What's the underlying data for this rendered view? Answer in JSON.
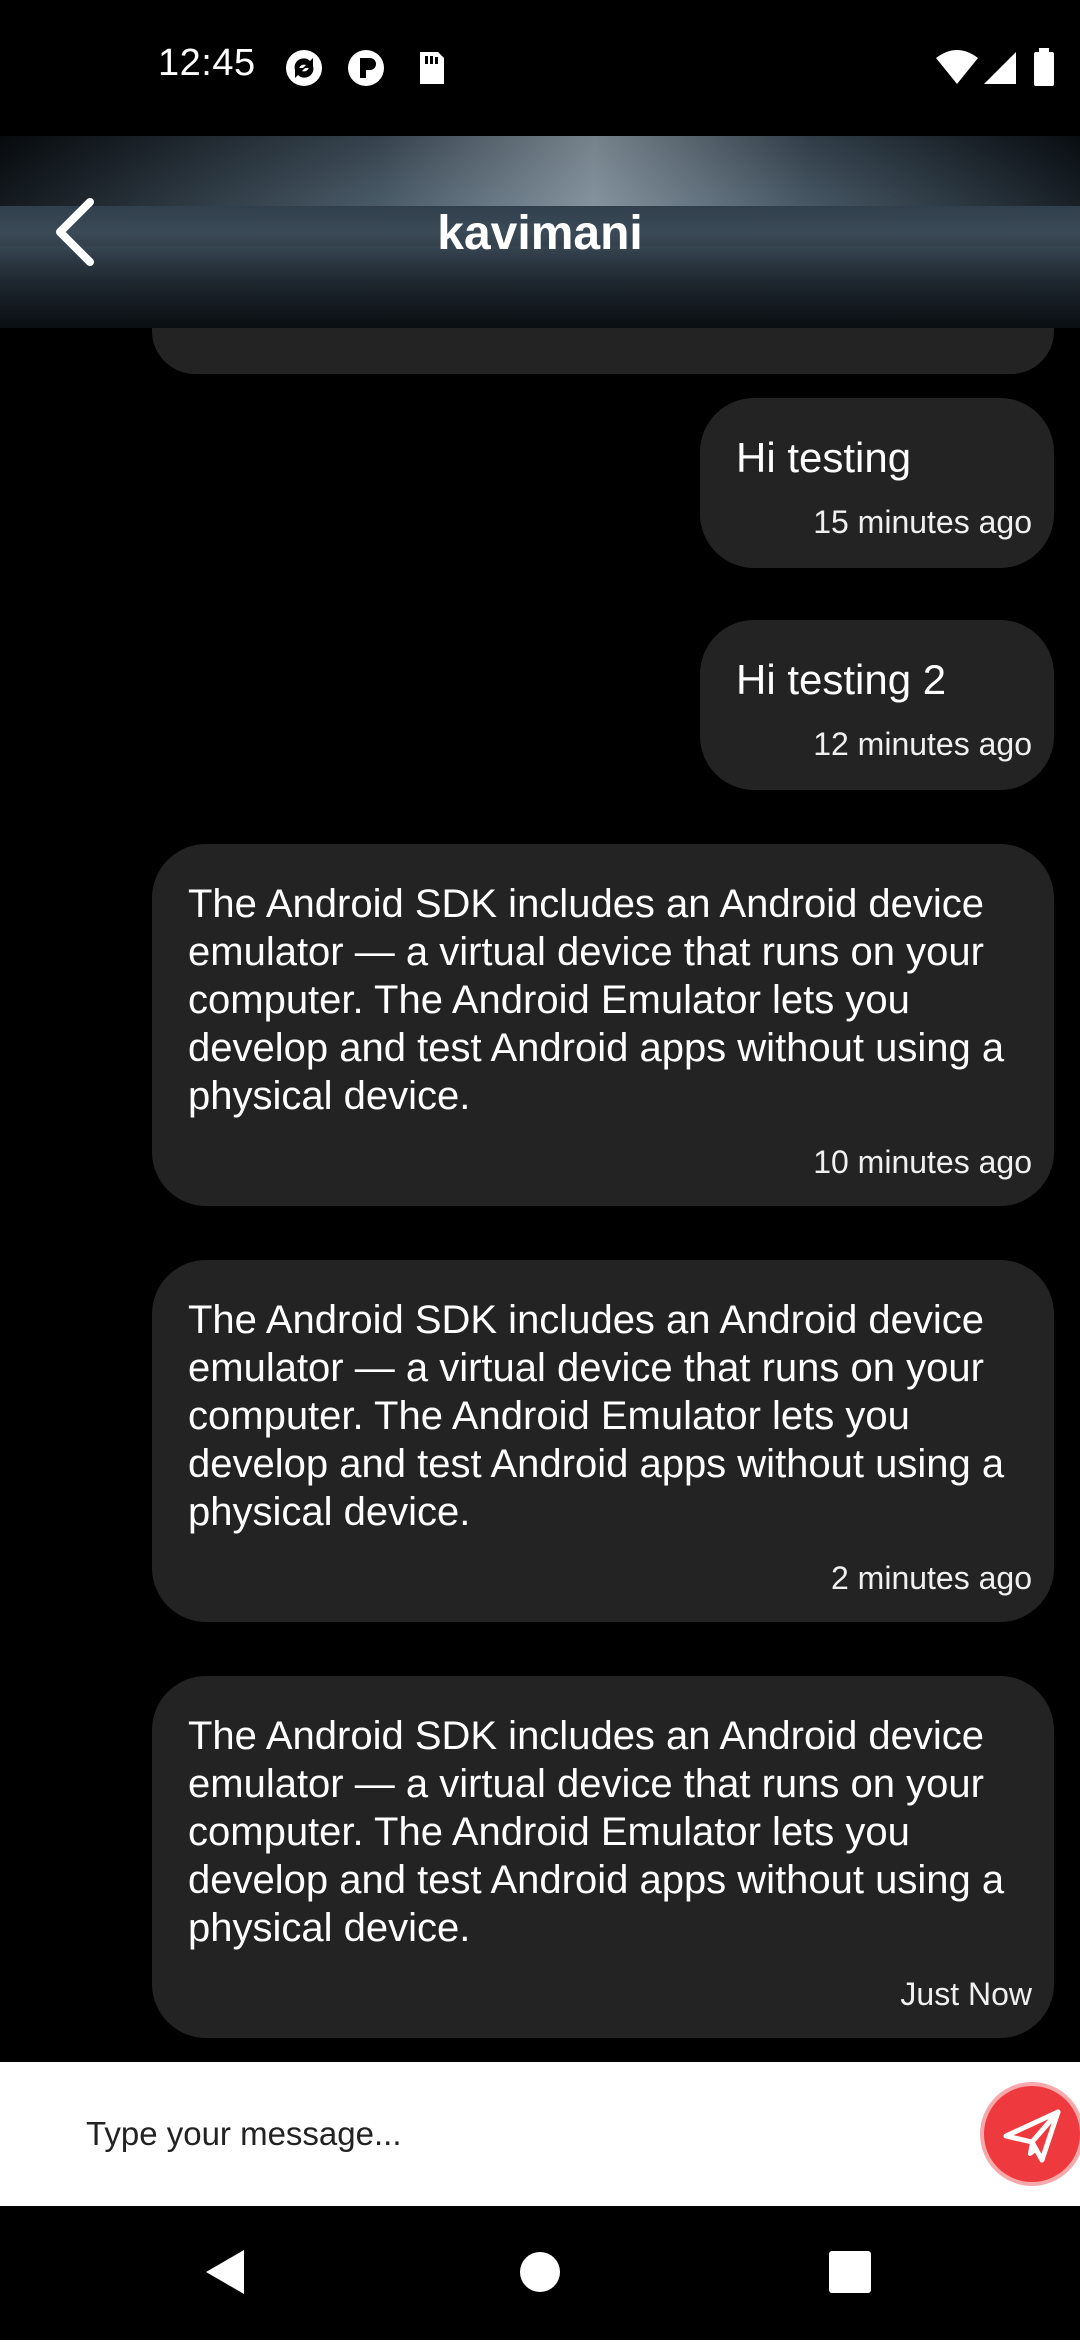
{
  "status_bar": {
    "time": "12:45",
    "icons_left": [
      "sync-icon",
      "pocket-icon",
      "sd-card-icon"
    ],
    "icons_right": [
      "wifi-icon",
      "signal-icon",
      "battery-icon"
    ]
  },
  "header": {
    "title": "kavimani",
    "back_icon": "chevron-left-icon"
  },
  "messages": [
    {
      "text": "Hi testing",
      "time": "15 minutes ago"
    },
    {
      "text": "Hi testing 2",
      "time": "12 minutes ago"
    },
    {
      "text": "The Android SDK includes an Android device emulator — a virtual device that runs on your computer. The Android Emulator lets you develop and test Android apps without using a physical device.",
      "time": "10 minutes ago"
    },
    {
      "text": "The Android SDK includes an Android device emulator — a virtual device that runs on your computer. The Android Emulator lets you develop and test Android apps without using a physical device.",
      "time": "2 minutes ago"
    },
    {
      "text": "The Android SDK includes an Android device emulator — a virtual device that runs on your computer. The Android Emulator lets you develop and test Android apps without using a physical device.",
      "time": "Just Now"
    }
  ],
  "composer": {
    "placeholder": "Type your message...",
    "value": "",
    "send_icon": "send-icon",
    "send_color": "#ee3a3e"
  },
  "nav_bar": {
    "buttons": [
      "back-triangle-icon",
      "home-circle-icon",
      "recents-square-icon"
    ]
  }
}
